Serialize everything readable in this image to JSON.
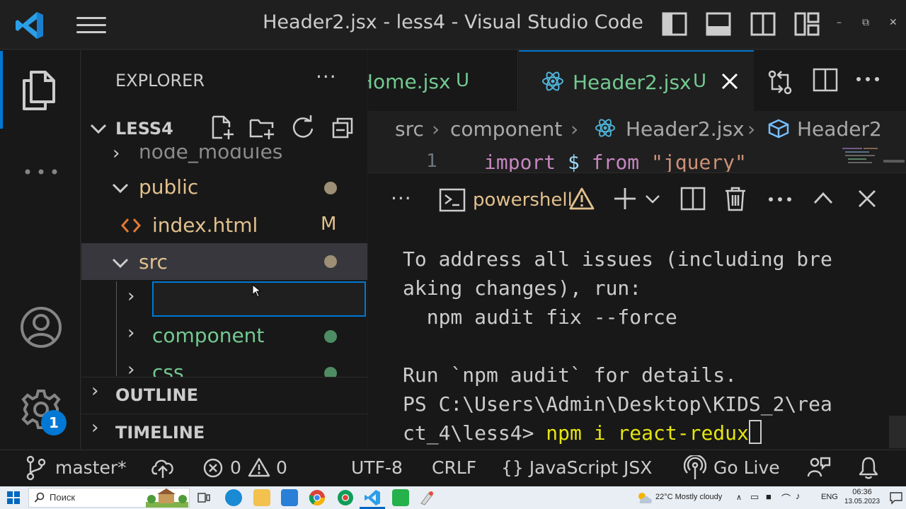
{
  "window": {
    "title": "Header2.jsx - less4 - Visual Studio Code",
    "minimize": "–",
    "restore": "⧉",
    "close": "✕"
  },
  "activity_bar": {
    "badge_count": "1"
  },
  "explorer": {
    "title": "EXPLORER",
    "more": "···",
    "project": "LESS4",
    "tree": {
      "node_modules": "node_modules",
      "public": "public",
      "index_html": "index.html",
      "index_html_badge": "M",
      "src": "src",
      "component": "component",
      "css": "css"
    },
    "rename_value": ""
  },
  "sections": {
    "outline": "OUTLINE",
    "timeline": "TIMELINE"
  },
  "tabs": [
    {
      "label": "Home.jsx",
      "status": "U",
      "active": false
    },
    {
      "label": "Header2.jsx",
      "status": "U",
      "active": true
    }
  ],
  "breadcrumb": [
    "src",
    "component",
    "Header2.jsx",
    "Header2"
  ],
  "editor": {
    "line_number": "1",
    "code_keyword": "import",
    "code_ident": "$",
    "code_from": "from",
    "code_string": "\"jquery\""
  },
  "terminal": {
    "more": "···",
    "shell_name": "powershell",
    "lines": [
      "To address all issues (including bre",
      "aking changes), run:",
      "  npm audit fix --force",
      "",
      "Run `npm audit` for details.",
      "PS C:\\Users\\Admin\\Desktop\\KIDS_2\\rea"
    ],
    "prompt_line": "ct_4\\less4> ",
    "command": "npm i react-redux"
  },
  "status_bar": {
    "branch": "master*",
    "errors": "0",
    "warnings": "0",
    "encoding": "UTF-8",
    "eol": "CRLF",
    "language": "JavaScript JSX",
    "language_prefix": "{}",
    "go_live": "Go Live"
  },
  "taskbar": {
    "search_placeholder": "Поиск",
    "weather": "22°C  Mostly cloudy",
    "lang": "ENG",
    "time": "06:36",
    "date": "13.05.2023"
  },
  "colors": {
    "accent": "#0078d4",
    "untracked": "#73c991",
    "modified": "#e2c08d",
    "folder": "#e2c08d"
  }
}
